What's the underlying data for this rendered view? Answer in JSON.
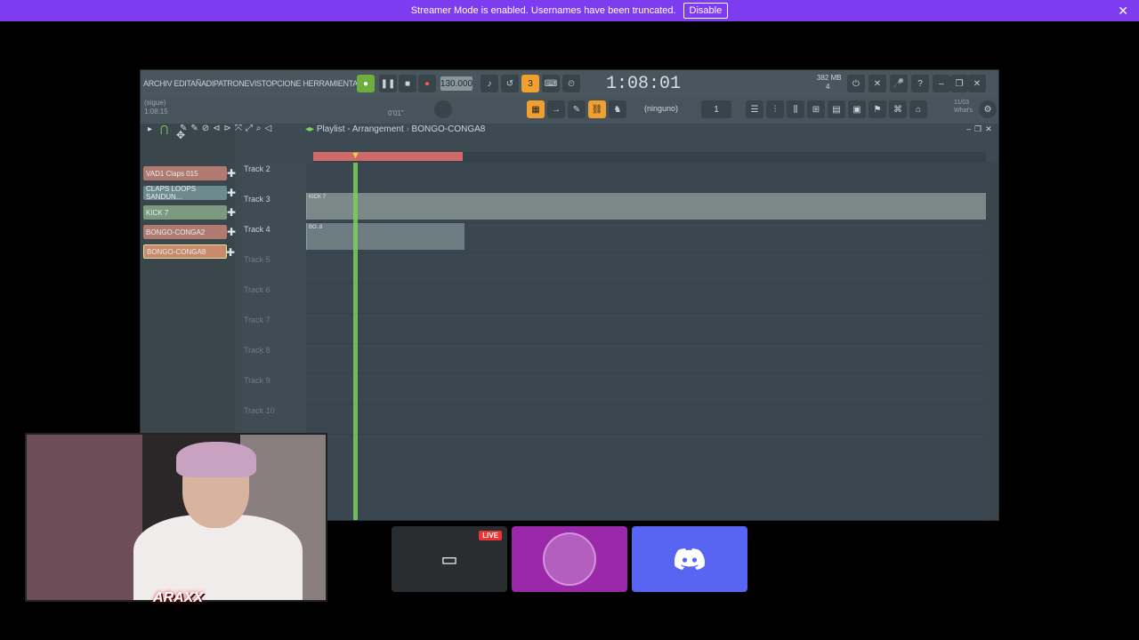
{
  "banner": {
    "message": "Streamer Mode is enabled. Usernames have been truncated.",
    "disable_label": "Disable",
    "close": "✕"
  },
  "fl": {
    "menu": "ARCHIV EDITAÑADIPATRONEVISTOPCIONE HERRAMIENTAY",
    "bpm": "130.000",
    "time": "1:08:01",
    "mem": "382 MB",
    "mem_sub": "4",
    "hint1": "(sigue)",
    "hint2": "1:08:15",
    "hint3": "0'01\"",
    "pattern_sel": "(ninguno)",
    "whats1": "11/03",
    "whats2": "What's",
    "playlist_title": "Playlist - Arrangement",
    "playlist_pattern": "BONGO-CONGA8",
    "channels": [
      {
        "label": "VAD1 Claps 015"
      },
      {
        "label": "CLAPS LOOPS SANDUN..."
      },
      {
        "label": "KICK 7"
      },
      {
        "label": "BONGO-CONGA2"
      },
      {
        "label": "BONGO-CONGA8"
      }
    ],
    "tracks": [
      "Track 2",
      "Track 3",
      "Track 4",
      "Track 5",
      "Track 6",
      "Track 7",
      "Track 8",
      "Track 9",
      "Track 10"
    ],
    "clip_kick": "KICK 7",
    "clip_bongo": "BO..8"
  },
  "tiles": {
    "live": "LIVE"
  },
  "webcam": {
    "logo": "ARAXX"
  },
  "colors": {
    "banner": "#7e3cf0",
    "discord": "#5865f2",
    "tile_avatar": "#9a28a8",
    "playhead": "#7dd05a",
    "loop": "#d06a6a"
  }
}
